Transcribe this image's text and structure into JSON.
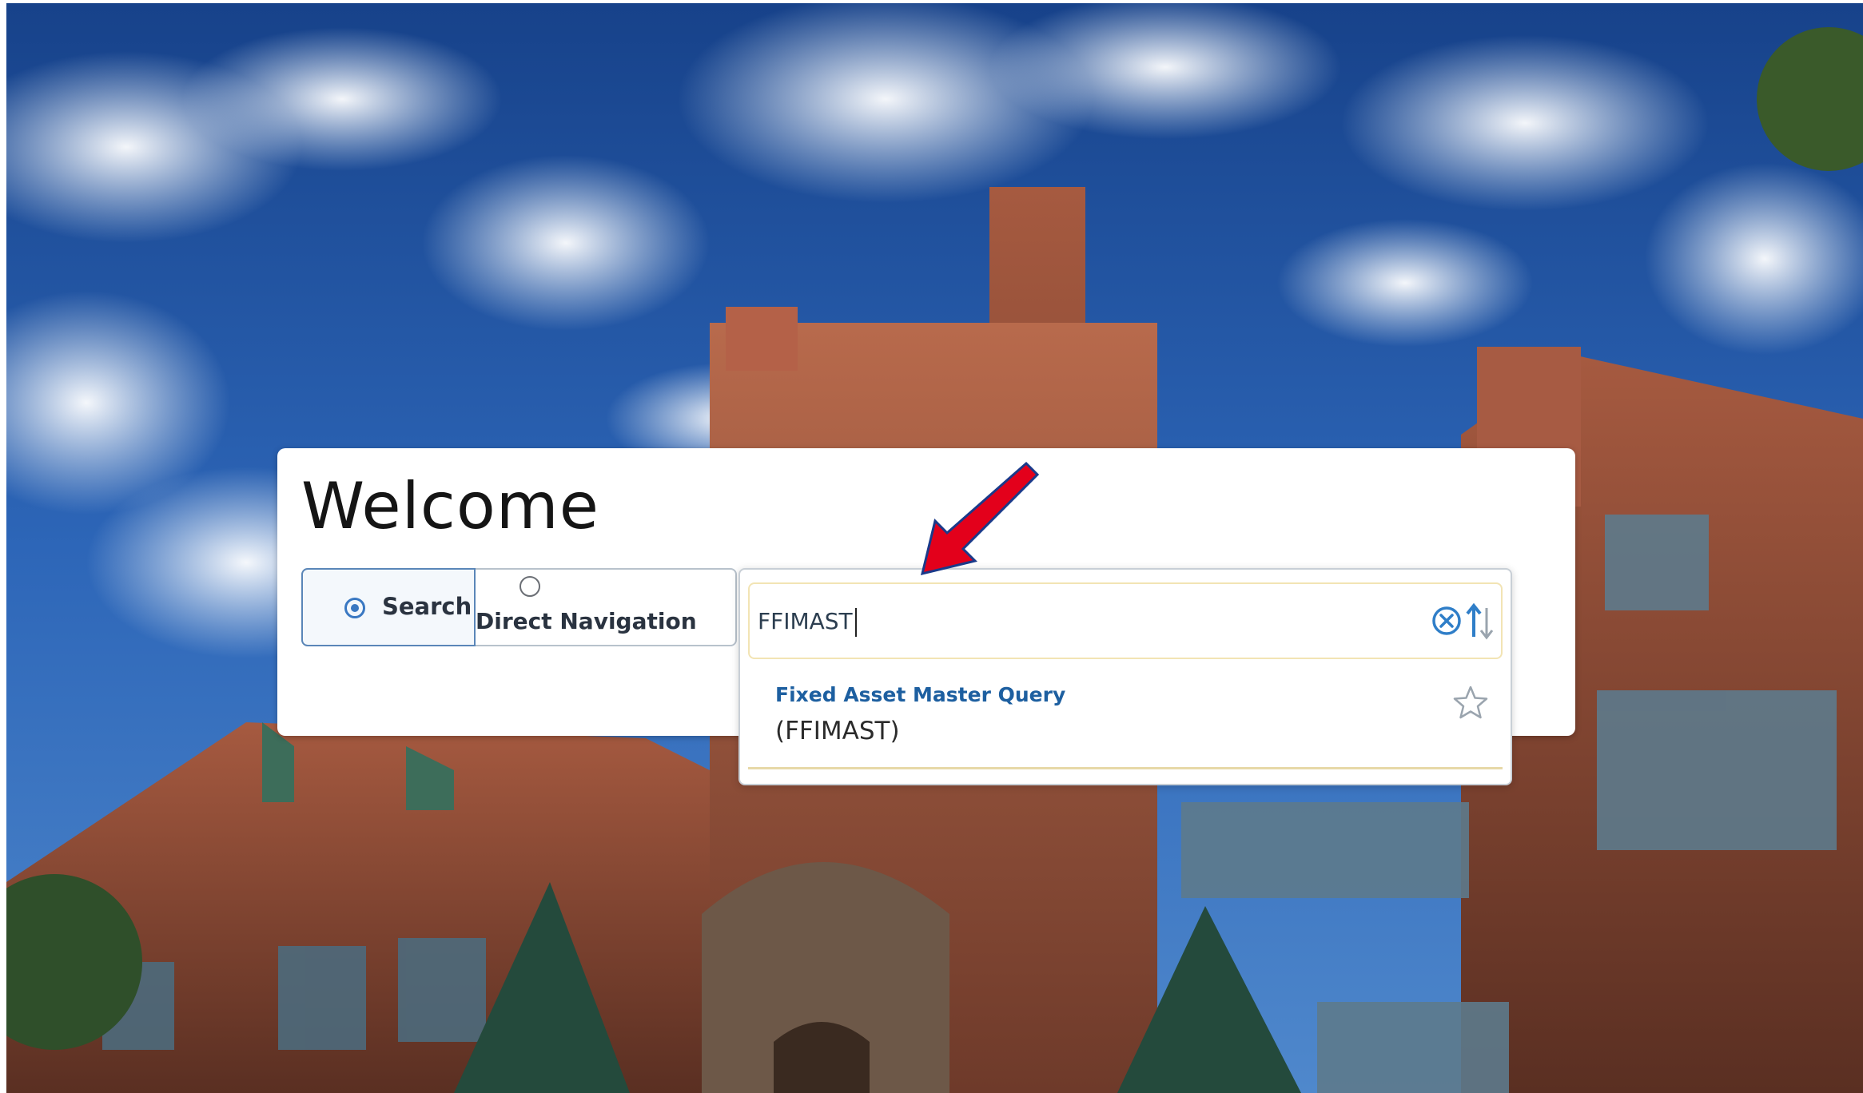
{
  "welcome": {
    "title": "Welcome"
  },
  "mode": {
    "search_label": "Search",
    "direct_label": "Direct Navigation",
    "selected": "search"
  },
  "search": {
    "value": "FFIMAST",
    "results": [
      {
        "title": "Fixed Asset Master Query",
        "code": "(FFIMAST)"
      }
    ]
  },
  "icons": {
    "clear": "clear-circle-x-icon",
    "sort": "sort-arrows-icon",
    "favorite": "star-outline-icon",
    "annotation": "red-arrow-icon"
  },
  "colors": {
    "accent": "#3a78c2",
    "link": "#1d5fa0",
    "annotation": "#e3001b"
  }
}
